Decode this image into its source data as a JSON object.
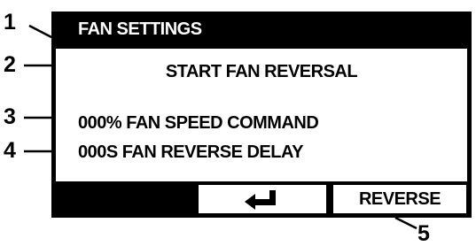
{
  "callouts": [
    "1",
    "2",
    "3",
    "4",
    "5"
  ],
  "screen": {
    "title": "FAN SETTINGS",
    "headline": "START FAN REVERSAL",
    "line3": "000% FAN SPEED COMMAND",
    "line4": "000S FAN REVERSE DELAY"
  },
  "softkeys": {
    "back_icon": "enter-return-arrow-icon",
    "reverse_label": "REVERSE"
  }
}
